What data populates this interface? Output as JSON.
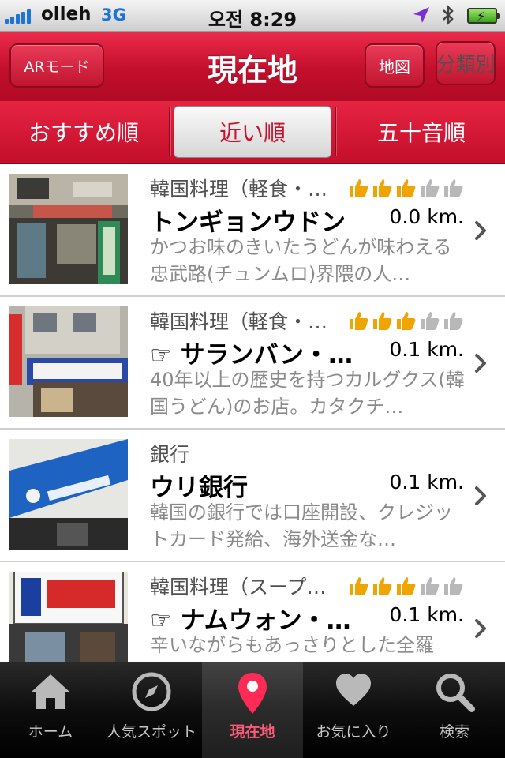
{
  "status_bar": {
    "carrier": "olleh",
    "network": "3G",
    "time": "오전 8:29"
  },
  "header": {
    "title": "現在地",
    "ar_button": "ARモード",
    "map_button": "地図",
    "category_button": "分類別"
  },
  "sort_tabs": [
    {
      "label": "おすすめ順",
      "selected": false
    },
    {
      "label": "近い順",
      "selected": true
    },
    {
      "label": "五十音順",
      "selected": false
    }
  ],
  "colors": {
    "accent_red": "#c8102e",
    "star_gold": "#f0a400"
  },
  "items": [
    {
      "category": "韓国料理（軽食・…",
      "rating": 3,
      "name": "トンギョンウドン",
      "distance": "0.0 km.",
      "description": "かつお味のきいたうどんが味わえる忠武路(チュンムロ)界隈の人…",
      "photo": "shop-front-photo"
    },
    {
      "category": "韓国料理（軽食・…",
      "rating": 3,
      "name": "☞ サランバン・…",
      "distance": "0.1 km.",
      "description": "40年以上の歴史を持つカルグクス(韓国うどん)のお店。カタクチ…",
      "photo": "building-sign-photo"
    },
    {
      "category": "銀行",
      "rating": 0,
      "name": "ウリ銀行",
      "distance": "0.1 km.",
      "description": "韓国の銀行では口座開設、クレジットカード発給、海外送金な…",
      "photo": "bank-sign-photo"
    },
    {
      "category": "韓国料理（スープ…",
      "rating": 3,
      "name": "☞ ナムウォン・…",
      "distance": "0.1 km.",
      "description": "辛いながらもあっさりとした全羅",
      "photo": "restaurant-sign-photo"
    }
  ],
  "tabbar": [
    {
      "label": "ホーム",
      "icon": "home-icon",
      "active": false
    },
    {
      "label": "人気スポット",
      "icon": "compass-icon",
      "active": false
    },
    {
      "label": "現在地",
      "icon": "map-pin-icon",
      "active": true
    },
    {
      "label": "お気に入り",
      "icon": "heart-icon",
      "active": false
    },
    {
      "label": "検索",
      "icon": "search-icon",
      "active": false
    }
  ]
}
